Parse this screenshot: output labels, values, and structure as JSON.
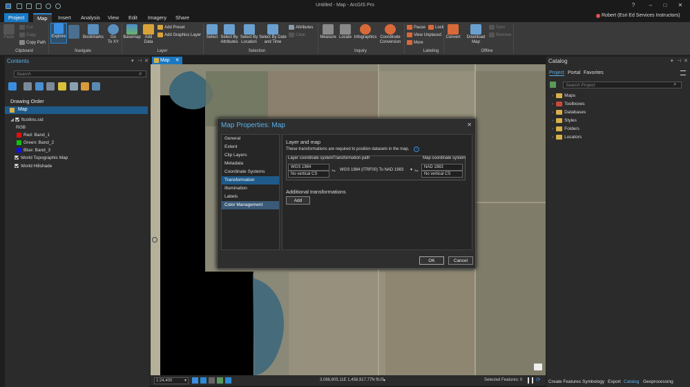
{
  "window": {
    "title": "Untitled - Map - ArcGIS Pro",
    "user": "Robert (Esri Ed Services Instructors)",
    "help": "?",
    "minimize": "–",
    "maximize": "□",
    "close": "✕"
  },
  "tabs": [
    "Project",
    "Map",
    "Insert",
    "Analysis",
    "View",
    "Edit",
    "Imagery",
    "Share"
  ],
  "ribbon": {
    "clipboard": {
      "paste": "Paste",
      "cut": "Cut",
      "copy": "Copy",
      "copy_path": "Copy Path",
      "group": "Clipboard"
    },
    "navigate": {
      "explore": "Explore",
      "bookmarks": "Bookmarks",
      "go_to_xy": "Go\nTo XY",
      "group": "Navigate"
    },
    "layer": {
      "basemap": "Basemap",
      "add_data": "Add\nData",
      "add_preset": "Add Preset",
      "add_graphics_layer": "Add Graphics Layer",
      "group": "Layer"
    },
    "selection": {
      "select": "Select",
      "by_attributes": "Select By\nAttributes",
      "by_location": "Select By\nLocation",
      "by_date_time": "Select By Date\nand Time",
      "attributes": "Attributes",
      "clear": "Clear",
      "group": "Selection"
    },
    "inquiry": {
      "measure": "Measure",
      "locate": "Locate",
      "infographics": "Infographics",
      "coordinate_conversion": "Coordinate\nConversion",
      "group": "Inquiry"
    },
    "labeling": {
      "pause": "Pause",
      "lock": "Lock",
      "view_unplaced": "View Unplaced",
      "more": "More",
      "group": "Labeling"
    },
    "offline": {
      "convert": "Convert",
      "download_map": "Download\nMap",
      "sync": "Sync",
      "remove": "Remove",
      "group": "Offline"
    }
  },
  "contents": {
    "title": "Contents",
    "search_placeholder": "Search",
    "drawing_order": "Drawing Order",
    "map": "Map",
    "layer": "ftcollins.sid",
    "rgb": "RGB",
    "bands": [
      {
        "label": "Red:  Band_1",
        "color": "#e01010"
      },
      {
        "label": "Green:  Band_2",
        "color": "#10c010"
      },
      {
        "label": "Blue:  Band_3",
        "color": "#1010e0"
      }
    ],
    "basemaps": [
      "World Topographic Map",
      "World Hillshade"
    ]
  },
  "map_tab": "Map",
  "status": {
    "scale": "1:24,400",
    "coordinates": "3,088,805.11E 1,458,917.77N ftUS",
    "selected": "Selected Features: 0"
  },
  "dialog": {
    "title": "Map Properties: Map",
    "nav": [
      "General",
      "Extent",
      "Clip Layers",
      "Metadata",
      "Coordinate Systems",
      "Transformation",
      "Illumination",
      "Labels",
      "Color Management"
    ],
    "heading": "Layer and map",
    "description": "These transformations are required to position datasets in the map.",
    "col_layer": "Layer coordinate system",
    "col_path": "Transformation path",
    "col_map": "Map coordinate system",
    "layer_cs": "WGS 1984",
    "layer_vcs": "No vertical CS",
    "path": "WGS 1984 (ITRF00) To NAD 1983",
    "map_cs": "NAD 1983",
    "map_vcs": "No vertical CS",
    "additional": "Additional transformations",
    "add": "Add",
    "ok": "OK",
    "cancel": "Cancel"
  },
  "catalog": {
    "title": "Catalog",
    "tabs": [
      "Project",
      "Portal",
      "Favorites"
    ],
    "search_placeholder": "Search Project",
    "items": [
      "Maps",
      "Toolboxes",
      "Databases",
      "Styles",
      "Folders",
      "Locators"
    ],
    "footer_tabs": [
      "Create Features",
      "Symbology",
      "Export",
      "Catalog",
      "Geoprocessing"
    ]
  }
}
